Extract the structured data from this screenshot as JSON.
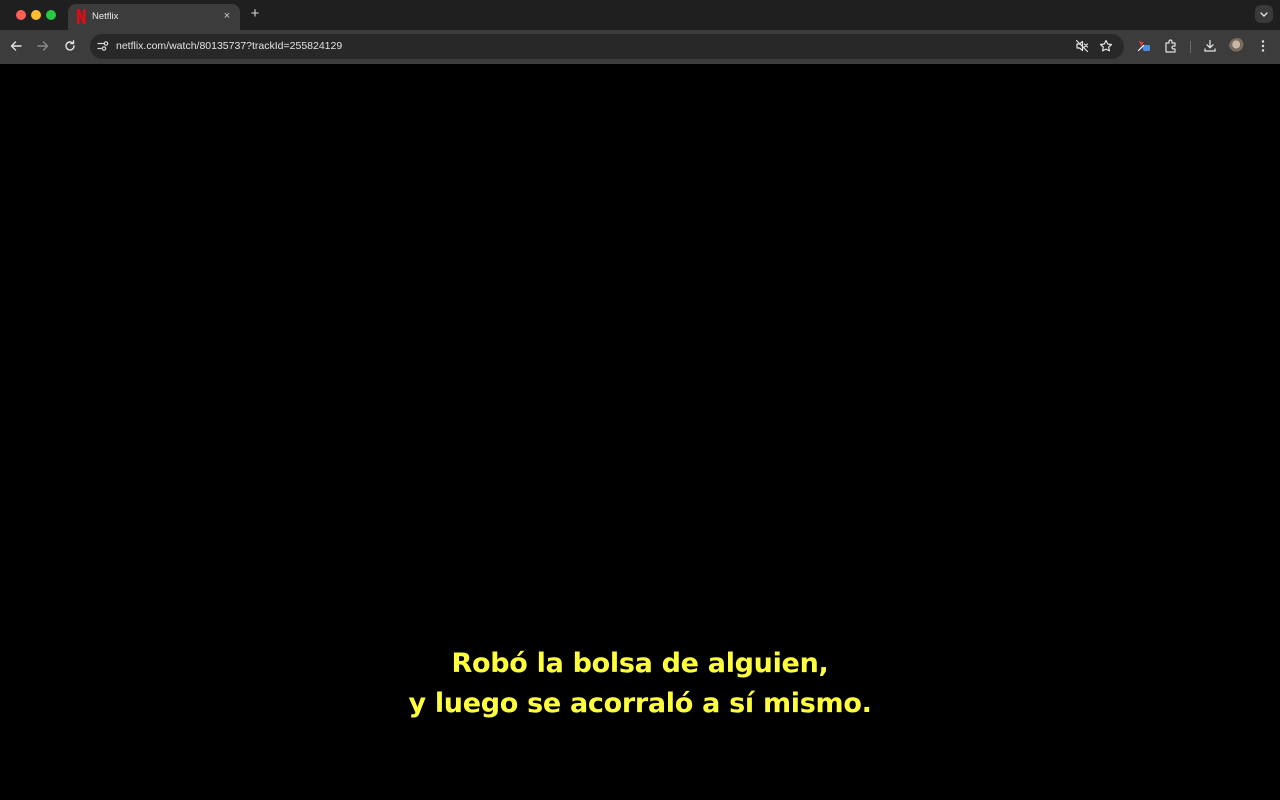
{
  "browser": {
    "tab": {
      "title": "Netflix",
      "close_glyph": "×",
      "favicon": "netflix-n-icon"
    },
    "new_tab_glyph": "+",
    "toolbar": {
      "url": "netflix.com/watch/80135737?trackId=255824129"
    },
    "icons": [
      "back-icon",
      "forward-icon",
      "reload-icon",
      "site-info-icon",
      "muted-icon",
      "bookmark-star-icon",
      "extension-icon",
      "puzzle-icon",
      "download-icon",
      "menu-icon"
    ]
  },
  "player": {
    "subtitles": [
      "Robó la bolsa de alguien,",
      "y luego se acorraló a sí mismo."
    ],
    "subtitle_color": "#ffff3c"
  },
  "colors": {
    "netflix_red": "#e50914",
    "chrome_dark": "#1f1f1f",
    "toolbar": "#3c3c3c"
  }
}
